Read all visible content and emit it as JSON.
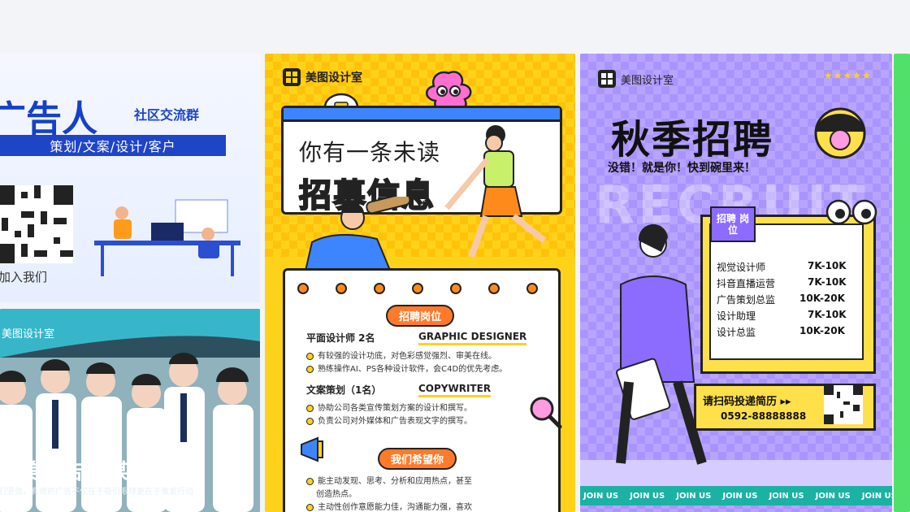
{
  "card1": {
    "title": "广告人",
    "subtitle": "社区交流群",
    "tags": "策划/文案/设计/客户",
    "join": "加入我们"
  },
  "card2": {
    "brand": "美图设计室",
    "title": "小美广告传媒公司",
    "slogan": "们坚信，有效的广告不仅在于吸引眼球更在于激发行动"
  },
  "card3": {
    "brand": "美图设计室",
    "line1": "你有一条未读",
    "line2": "招募信息",
    "section1": "招聘岗位",
    "job1": "平面设计师 2名",
    "job1_en": "GRAPHIC DESIGNER",
    "job1_items": [
      "有较强的设计功底，对色彩感觉强烈、审美在线。",
      "熟练操作AI、PS各种设计软件，会C4D的优先考虑。"
    ],
    "job2": "文案策划（1名）",
    "job2_en": "COPYWRITER",
    "job2_items": [
      "协助公司各类宣传策划方案的设计和撰写。",
      "负责公司对外媒体和广告表现文字的撰写。"
    ],
    "section2": "我们希望你",
    "wish_items": [
      "能主动发现、思考、分析和应用热点，甚至",
      "创造热点。",
      "主动性创作意愿能力佳，沟通能力强，喜欢"
    ]
  },
  "card4": {
    "brand": "美图设计室",
    "stars": "★★★★★",
    "title": "秋季招聘",
    "tagline": "没错！就是你！快到碗里来！",
    "watermark": "RECRUIT",
    "badge": "招聘 岗位",
    "jobs": [
      {
        "name": "视觉设计师",
        "salary": "7K-10K"
      },
      {
        "name": "抖音直播运营",
        "salary": "7K-10K"
      },
      {
        "name": "广告策划总监",
        "salary": "10K-20K"
      },
      {
        "name": "设计助理",
        "salary": "7K-10K"
      },
      {
        "name": "设计总监",
        "salary": "10K-20K"
      }
    ],
    "cta": "请扫码投递简历 ▸▸",
    "phone": "0592-88888888",
    "strip": "JOIN US"
  },
  "colors": {
    "yellow": "#ffd21a",
    "purple": "#b8a4ff",
    "blue": "#1f45c7",
    "orange": "#ff7a2a",
    "green": "#51e06a"
  }
}
